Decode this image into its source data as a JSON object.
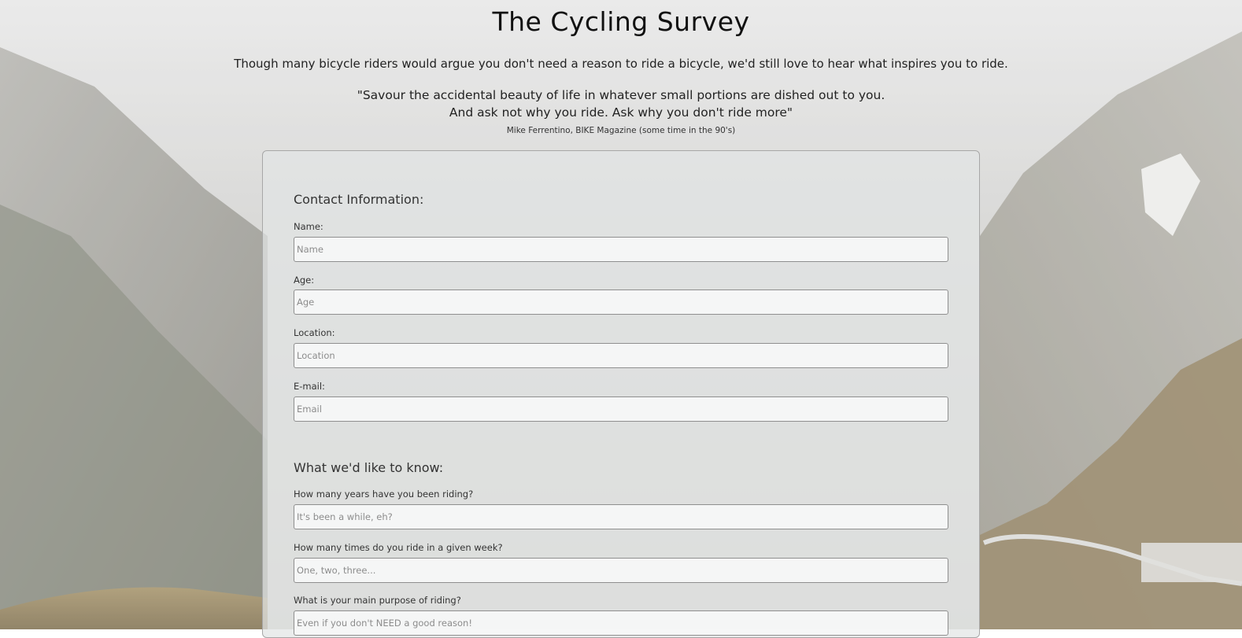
{
  "header": {
    "title": "The Cycling Survey",
    "intro": "Though many bicycle riders would argue you don't need a reason to ride a bicycle, we'd still love to hear what inspires you to ride.",
    "quote_line1": "\"Savour the accidental beauty of life in whatever small portions are dished out to you.",
    "quote_line2": "And ask not why you ride. Ask why you don't ride more\"",
    "attribution": "Mike Ferrentino, BIKE Magazine (some time in the 90's)"
  },
  "contact": {
    "heading": "Contact Information:",
    "name_label": "Name:",
    "name_placeholder": "Name",
    "age_label": "Age:",
    "age_placeholder": "Age",
    "location_label": "Location:",
    "location_placeholder": "Location",
    "email_label": "E-mail:",
    "email_placeholder": "Email"
  },
  "questions": {
    "heading": "What we'd like to know:",
    "years_label": "How many years have you been riding?",
    "years_placeholder": "It's been a while, eh?",
    "times_label": "How many times do you ride in a given week?",
    "times_placeholder": "One, two, three...",
    "purpose_label": "What is your main purpose of riding?",
    "purpose_placeholder": "Even if you don't NEED a good reason!"
  },
  "colors": {
    "card_background": "#e2e4e4",
    "card_border": "#a7a7a7",
    "input_border": "#8f8f8f"
  }
}
